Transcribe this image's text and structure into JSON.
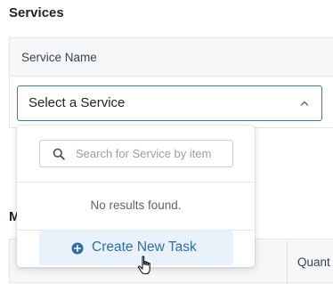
{
  "services_section": {
    "title": "Services",
    "column_header": "Service Name",
    "select": {
      "value": "Select a Service"
    }
  },
  "dropdown": {
    "search_placeholder": "Search for Service by item",
    "empty_message": "No results found.",
    "create_label": "Create New Task"
  },
  "second_section": {
    "title_visible": "M",
    "column_header_partial": "Quant"
  },
  "colors": {
    "accent": "#3f78a6",
    "create_bg": "#e9f2fb",
    "create_text": "#2f6fa7",
    "header_bg": "#f6f7f8"
  },
  "icons": {
    "search": "search-icon",
    "chevron": "chevron-up-icon",
    "plus": "plus-circle-icon",
    "cursor": "hand-pointer-cursor"
  }
}
